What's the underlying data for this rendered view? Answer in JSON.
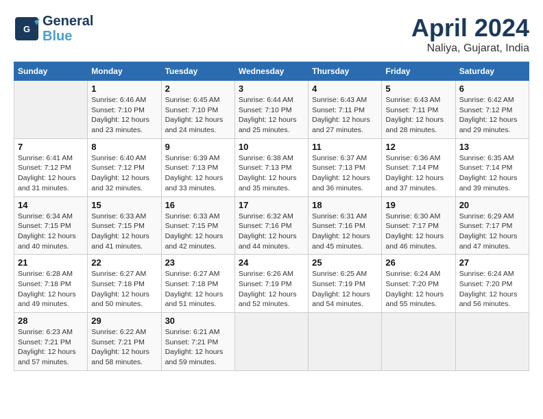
{
  "header": {
    "logo_line1": "General",
    "logo_line2": "Blue",
    "main_title": "April 2024",
    "subtitle": "Naliya, Gujarat, India"
  },
  "weekdays": [
    "Sunday",
    "Monday",
    "Tuesday",
    "Wednesday",
    "Thursday",
    "Friday",
    "Saturday"
  ],
  "weeks": [
    [
      {
        "day": "",
        "empty": true
      },
      {
        "day": "1",
        "sunrise": "Sunrise: 6:46 AM",
        "sunset": "Sunset: 7:10 PM",
        "daylight": "Daylight: 12 hours and 23 minutes."
      },
      {
        "day": "2",
        "sunrise": "Sunrise: 6:45 AM",
        "sunset": "Sunset: 7:10 PM",
        "daylight": "Daylight: 12 hours and 24 minutes."
      },
      {
        "day": "3",
        "sunrise": "Sunrise: 6:44 AM",
        "sunset": "Sunset: 7:10 PM",
        "daylight": "Daylight: 12 hours and 25 minutes."
      },
      {
        "day": "4",
        "sunrise": "Sunrise: 6:43 AM",
        "sunset": "Sunset: 7:11 PM",
        "daylight": "Daylight: 12 hours and 27 minutes."
      },
      {
        "day": "5",
        "sunrise": "Sunrise: 6:43 AM",
        "sunset": "Sunset: 7:11 PM",
        "daylight": "Daylight: 12 hours and 28 minutes."
      },
      {
        "day": "6",
        "sunrise": "Sunrise: 6:42 AM",
        "sunset": "Sunset: 7:12 PM",
        "daylight": "Daylight: 12 hours and 29 minutes."
      }
    ],
    [
      {
        "day": "7",
        "sunrise": "Sunrise: 6:41 AM",
        "sunset": "Sunset: 7:12 PM",
        "daylight": "Daylight: 12 hours and 31 minutes."
      },
      {
        "day": "8",
        "sunrise": "Sunrise: 6:40 AM",
        "sunset": "Sunset: 7:12 PM",
        "daylight": "Daylight: 12 hours and 32 minutes."
      },
      {
        "day": "9",
        "sunrise": "Sunrise: 6:39 AM",
        "sunset": "Sunset: 7:13 PM",
        "daylight": "Daylight: 12 hours and 33 minutes."
      },
      {
        "day": "10",
        "sunrise": "Sunrise: 6:38 AM",
        "sunset": "Sunset: 7:13 PM",
        "daylight": "Daylight: 12 hours and 35 minutes."
      },
      {
        "day": "11",
        "sunrise": "Sunrise: 6:37 AM",
        "sunset": "Sunset: 7:13 PM",
        "daylight": "Daylight: 12 hours and 36 minutes."
      },
      {
        "day": "12",
        "sunrise": "Sunrise: 6:36 AM",
        "sunset": "Sunset: 7:14 PM",
        "daylight": "Daylight: 12 hours and 37 minutes."
      },
      {
        "day": "13",
        "sunrise": "Sunrise: 6:35 AM",
        "sunset": "Sunset: 7:14 PM",
        "daylight": "Daylight: 12 hours and 39 minutes."
      }
    ],
    [
      {
        "day": "14",
        "sunrise": "Sunrise: 6:34 AM",
        "sunset": "Sunset: 7:15 PM",
        "daylight": "Daylight: 12 hours and 40 minutes."
      },
      {
        "day": "15",
        "sunrise": "Sunrise: 6:33 AM",
        "sunset": "Sunset: 7:15 PM",
        "daylight": "Daylight: 12 hours and 41 minutes."
      },
      {
        "day": "16",
        "sunrise": "Sunrise: 6:33 AM",
        "sunset": "Sunset: 7:15 PM",
        "daylight": "Daylight: 12 hours and 42 minutes."
      },
      {
        "day": "17",
        "sunrise": "Sunrise: 6:32 AM",
        "sunset": "Sunset: 7:16 PM",
        "daylight": "Daylight: 12 hours and 44 minutes."
      },
      {
        "day": "18",
        "sunrise": "Sunrise: 6:31 AM",
        "sunset": "Sunset: 7:16 PM",
        "daylight": "Daylight: 12 hours and 45 minutes."
      },
      {
        "day": "19",
        "sunrise": "Sunrise: 6:30 AM",
        "sunset": "Sunset: 7:17 PM",
        "daylight": "Daylight: 12 hours and 46 minutes."
      },
      {
        "day": "20",
        "sunrise": "Sunrise: 6:29 AM",
        "sunset": "Sunset: 7:17 PM",
        "daylight": "Daylight: 12 hours and 47 minutes."
      }
    ],
    [
      {
        "day": "21",
        "sunrise": "Sunrise: 6:28 AM",
        "sunset": "Sunset: 7:18 PM",
        "daylight": "Daylight: 12 hours and 49 minutes."
      },
      {
        "day": "22",
        "sunrise": "Sunrise: 6:27 AM",
        "sunset": "Sunset: 7:18 PM",
        "daylight": "Daylight: 12 hours and 50 minutes."
      },
      {
        "day": "23",
        "sunrise": "Sunrise: 6:27 AM",
        "sunset": "Sunset: 7:18 PM",
        "daylight": "Daylight: 12 hours and 51 minutes."
      },
      {
        "day": "24",
        "sunrise": "Sunrise: 6:26 AM",
        "sunset": "Sunset: 7:19 PM",
        "daylight": "Daylight: 12 hours and 52 minutes."
      },
      {
        "day": "25",
        "sunrise": "Sunrise: 6:25 AM",
        "sunset": "Sunset: 7:19 PM",
        "daylight": "Daylight: 12 hours and 54 minutes."
      },
      {
        "day": "26",
        "sunrise": "Sunrise: 6:24 AM",
        "sunset": "Sunset: 7:20 PM",
        "daylight": "Daylight: 12 hours and 55 minutes."
      },
      {
        "day": "27",
        "sunrise": "Sunrise: 6:24 AM",
        "sunset": "Sunset: 7:20 PM",
        "daylight": "Daylight: 12 hours and 56 minutes."
      }
    ],
    [
      {
        "day": "28",
        "sunrise": "Sunrise: 6:23 AM",
        "sunset": "Sunset: 7:21 PM",
        "daylight": "Daylight: 12 hours and 57 minutes."
      },
      {
        "day": "29",
        "sunrise": "Sunrise: 6:22 AM",
        "sunset": "Sunset: 7:21 PM",
        "daylight": "Daylight: 12 hours and 58 minutes."
      },
      {
        "day": "30",
        "sunrise": "Sunrise: 6:21 AM",
        "sunset": "Sunset: 7:21 PM",
        "daylight": "Daylight: 12 hours and 59 minutes."
      },
      {
        "day": "",
        "empty": true
      },
      {
        "day": "",
        "empty": true
      },
      {
        "day": "",
        "empty": true
      },
      {
        "day": "",
        "empty": true
      }
    ]
  ]
}
